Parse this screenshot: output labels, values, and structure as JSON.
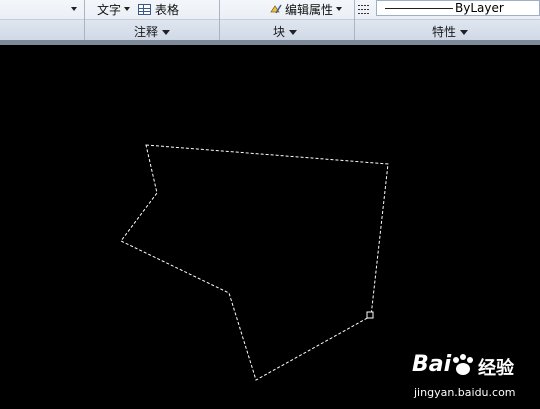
{
  "ribbon": {
    "text_button": "文字",
    "table_button": "表格",
    "edit_attr_button": "编辑属性",
    "linetype_value": "ByLayer",
    "panels": {
      "annotation": "注释",
      "block": "块",
      "properties": "特性"
    }
  },
  "drawing": {
    "selection_style": "dashed",
    "stroke_color": "#ffffff",
    "background_color": "#000000",
    "grip_icon": "square-grip-icon"
  },
  "watermark": {
    "brand_text_1": "Bai",
    "brand_text_2": "经验",
    "url": "jingyan.baidu.com",
    "icon": "paw-icon"
  }
}
